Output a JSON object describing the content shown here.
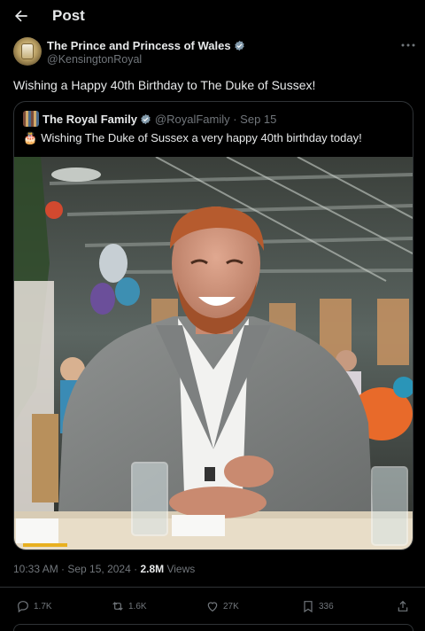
{
  "header": {
    "title": "Post",
    "back_icon": "arrow-left-icon"
  },
  "author": {
    "name": "The Prince and Princess of Wales",
    "handle": "@KensingtonRoyal",
    "verified_color": "#829aab"
  },
  "post": {
    "text": "Wishing a Happy 40th Birthday to The Duke of Sussex!"
  },
  "quoted_post": {
    "name": "The Royal Family",
    "handle": "@RoyalFamily · Sep 15",
    "emoji": "🎂",
    "text": "Wishing The Duke of Sussex a very happy 40th birthday today!"
  },
  "meta": {
    "time": "10:33 AM · Sep 15, 2024 · ",
    "views_count": "2.8M",
    "views_label": " Views"
  },
  "actions": {
    "replies": "1.7K",
    "reposts": "1.6K",
    "likes": "27K",
    "bookmarks": "336"
  },
  "colors": {
    "background": "#000000",
    "text": "#e7e9ea",
    "muted": "#71767b",
    "border": "#2f3336"
  }
}
